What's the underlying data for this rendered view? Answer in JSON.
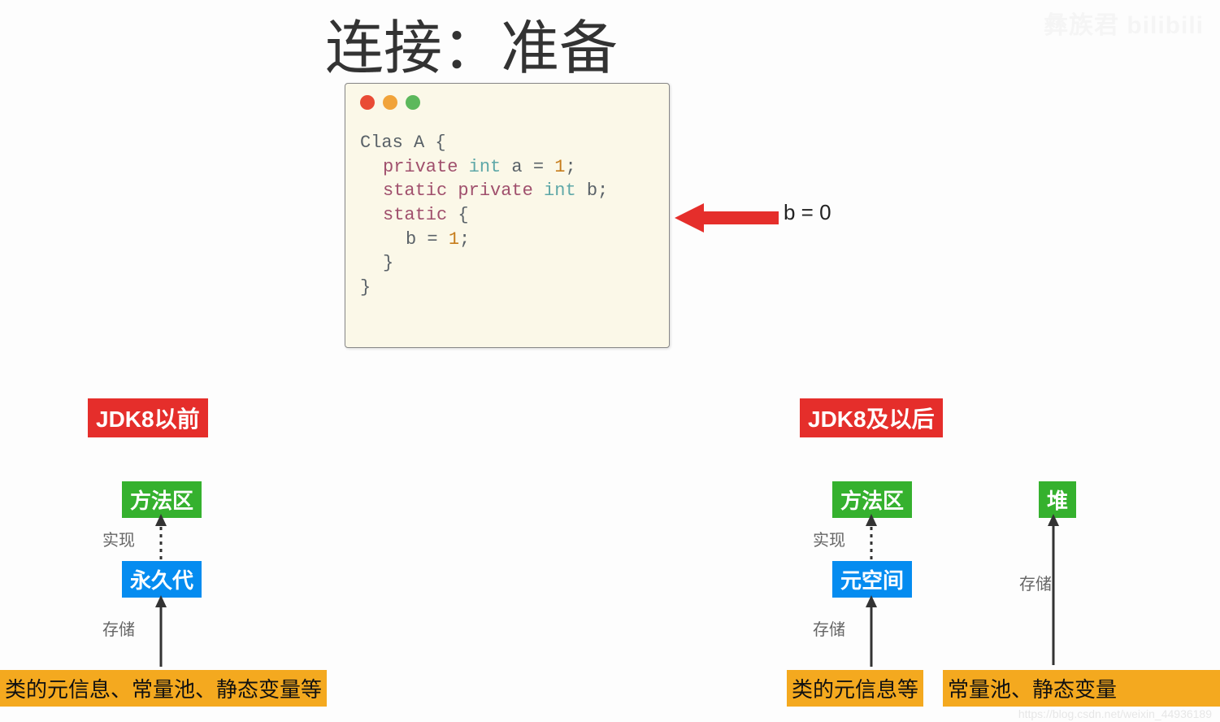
{
  "title": "连接：准备",
  "code": {
    "line1": "Clas A {",
    "line2_kw1": "private",
    "line2_kw2": "int",
    "line2_rest": " a = ",
    "line2_num": "1",
    "line2_end": ";",
    "line3_kw1a": "static",
    "line3_kw1b": "private",
    "line3_kw2": "int",
    "line3_rest": " b;",
    "line4_kw1": "static",
    "line4_rest": " {",
    "line5_a": "b = ",
    "line5_num": "1",
    "line5_end": ";",
    "line6": "}",
    "line7": "}"
  },
  "annotation": "b = 0",
  "left": {
    "header": "JDK8以前",
    "method_area": "方法区",
    "impl_label": "实现",
    "permgen": "永久代",
    "store_label": "存储",
    "storage": "类的元信息、常量池、静态变量等"
  },
  "right": {
    "header": "JDK8及以后",
    "method_area": "方法区",
    "impl_label": "实现",
    "metaspace": "元空间",
    "store_label": "存储",
    "storage1": "类的元信息等",
    "heap": "堆",
    "store_label2": "存储",
    "storage2": "常量池、静态变量"
  },
  "watermarks": {
    "top": "彝族君  bilibili",
    "bottom": "https://blog.csdn.net/weixin_44936189"
  }
}
